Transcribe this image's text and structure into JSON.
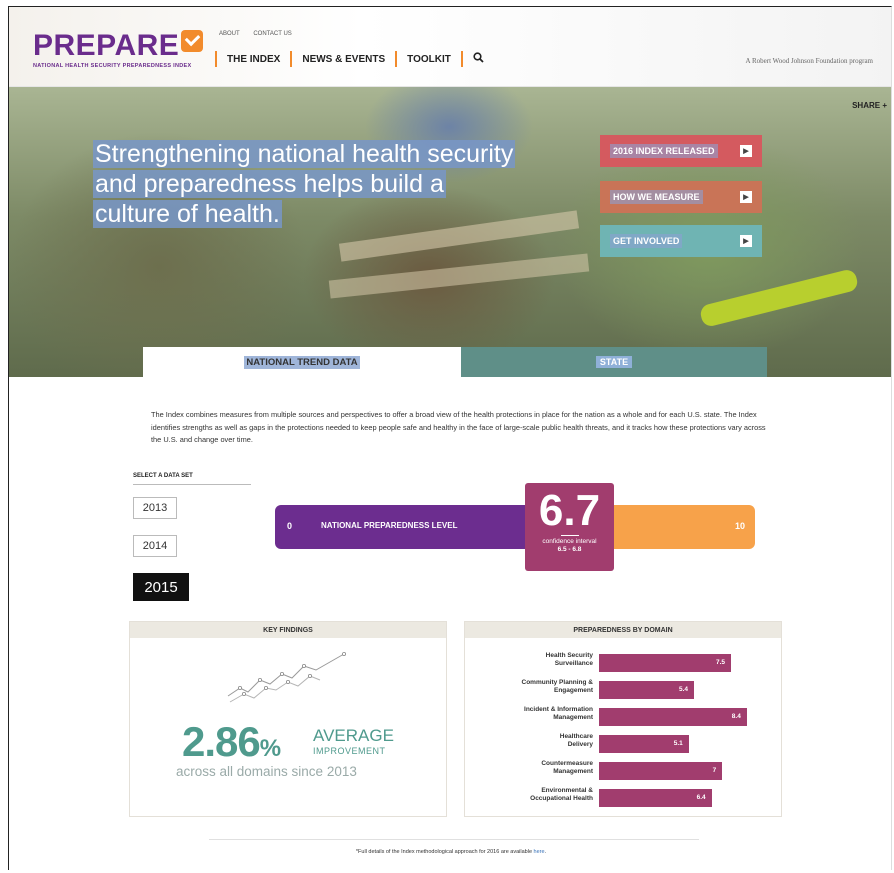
{
  "header": {
    "logo": "PREPARE",
    "tagline": "NATIONAL HEALTH SECURITY PREPAREDNESS INDEX",
    "top_links": [
      "ABOUT",
      "CONTACT US"
    ],
    "nav": [
      "THE INDEX",
      "NEWS & EVENTS",
      "TOOLKIT"
    ],
    "program": "A Robert Wood Johnson Foundation program"
  },
  "hero": {
    "headline": "Strengthening national health security and preparedness helps build a culture of health.",
    "share": "SHARE +",
    "buttons": [
      "2016 INDEX RELEASED",
      "HOW WE MEASURE",
      "GET INVOLVED"
    ]
  },
  "tabs": [
    "NATIONAL TREND DATA",
    "STATE"
  ],
  "intro": "The Index combines measures from multiple sources and perspectives to offer a broad view of the health protections in place for the nation as a whole and for each U.S. state. The Index identifies strengths as well as gaps in the protections needed to keep people safe and healthy in the face of large-scale public health threats, and it tracks how these protections vary across the U.S. and change over time.",
  "dataset": {
    "label": "SELECT A DATA SET",
    "years": [
      "2013",
      "2014",
      "2015"
    ],
    "selected": "2015"
  },
  "gauge": {
    "min": "0",
    "max": "10",
    "label": "NATIONAL PREPAREDNESS LEVEL",
    "score": "6.7",
    "ci_label": "confidence interval",
    "ci_range": "6.5 - 6.8"
  },
  "key_findings": {
    "title": "KEY FINDINGS",
    "value": "2.86",
    "unit": "%",
    "average": "AVERAGE",
    "improvement": "IMPROVEMENT",
    "since": "across all domains since 2013"
  },
  "domains": {
    "title": "PREPAREDNESS BY DOMAIN",
    "max": 10,
    "items": [
      {
        "label1": "Health Security",
        "label2": "Surveillance",
        "value": 7.5,
        "text": "7.5"
      },
      {
        "label1": "Community Planning &",
        "label2": "Engagement",
        "value": 5.4,
        "text": "5.4"
      },
      {
        "label1": "Incident & Information",
        "label2": "Management",
        "value": 8.4,
        "text": "8.4"
      },
      {
        "label1": "Healthcare",
        "label2": "Delivery",
        "value": 5.1,
        "text": "5.1"
      },
      {
        "label1": "Countermeasure",
        "label2": "Management",
        "value": 7,
        "text": "7"
      },
      {
        "label1": "Environmental &",
        "label2": "Occupational Health",
        "value": 6.4,
        "text": "6.4"
      }
    ]
  },
  "footnote": {
    "text": "*Full details of the Index methodological approach for 2016 are available ",
    "link": "here",
    "end": "."
  },
  "colors": {
    "purple": "#6c2d8f",
    "orange": "#f7a24a",
    "magenta": "#a13d6e",
    "teal": "#4f9a8d"
  }
}
